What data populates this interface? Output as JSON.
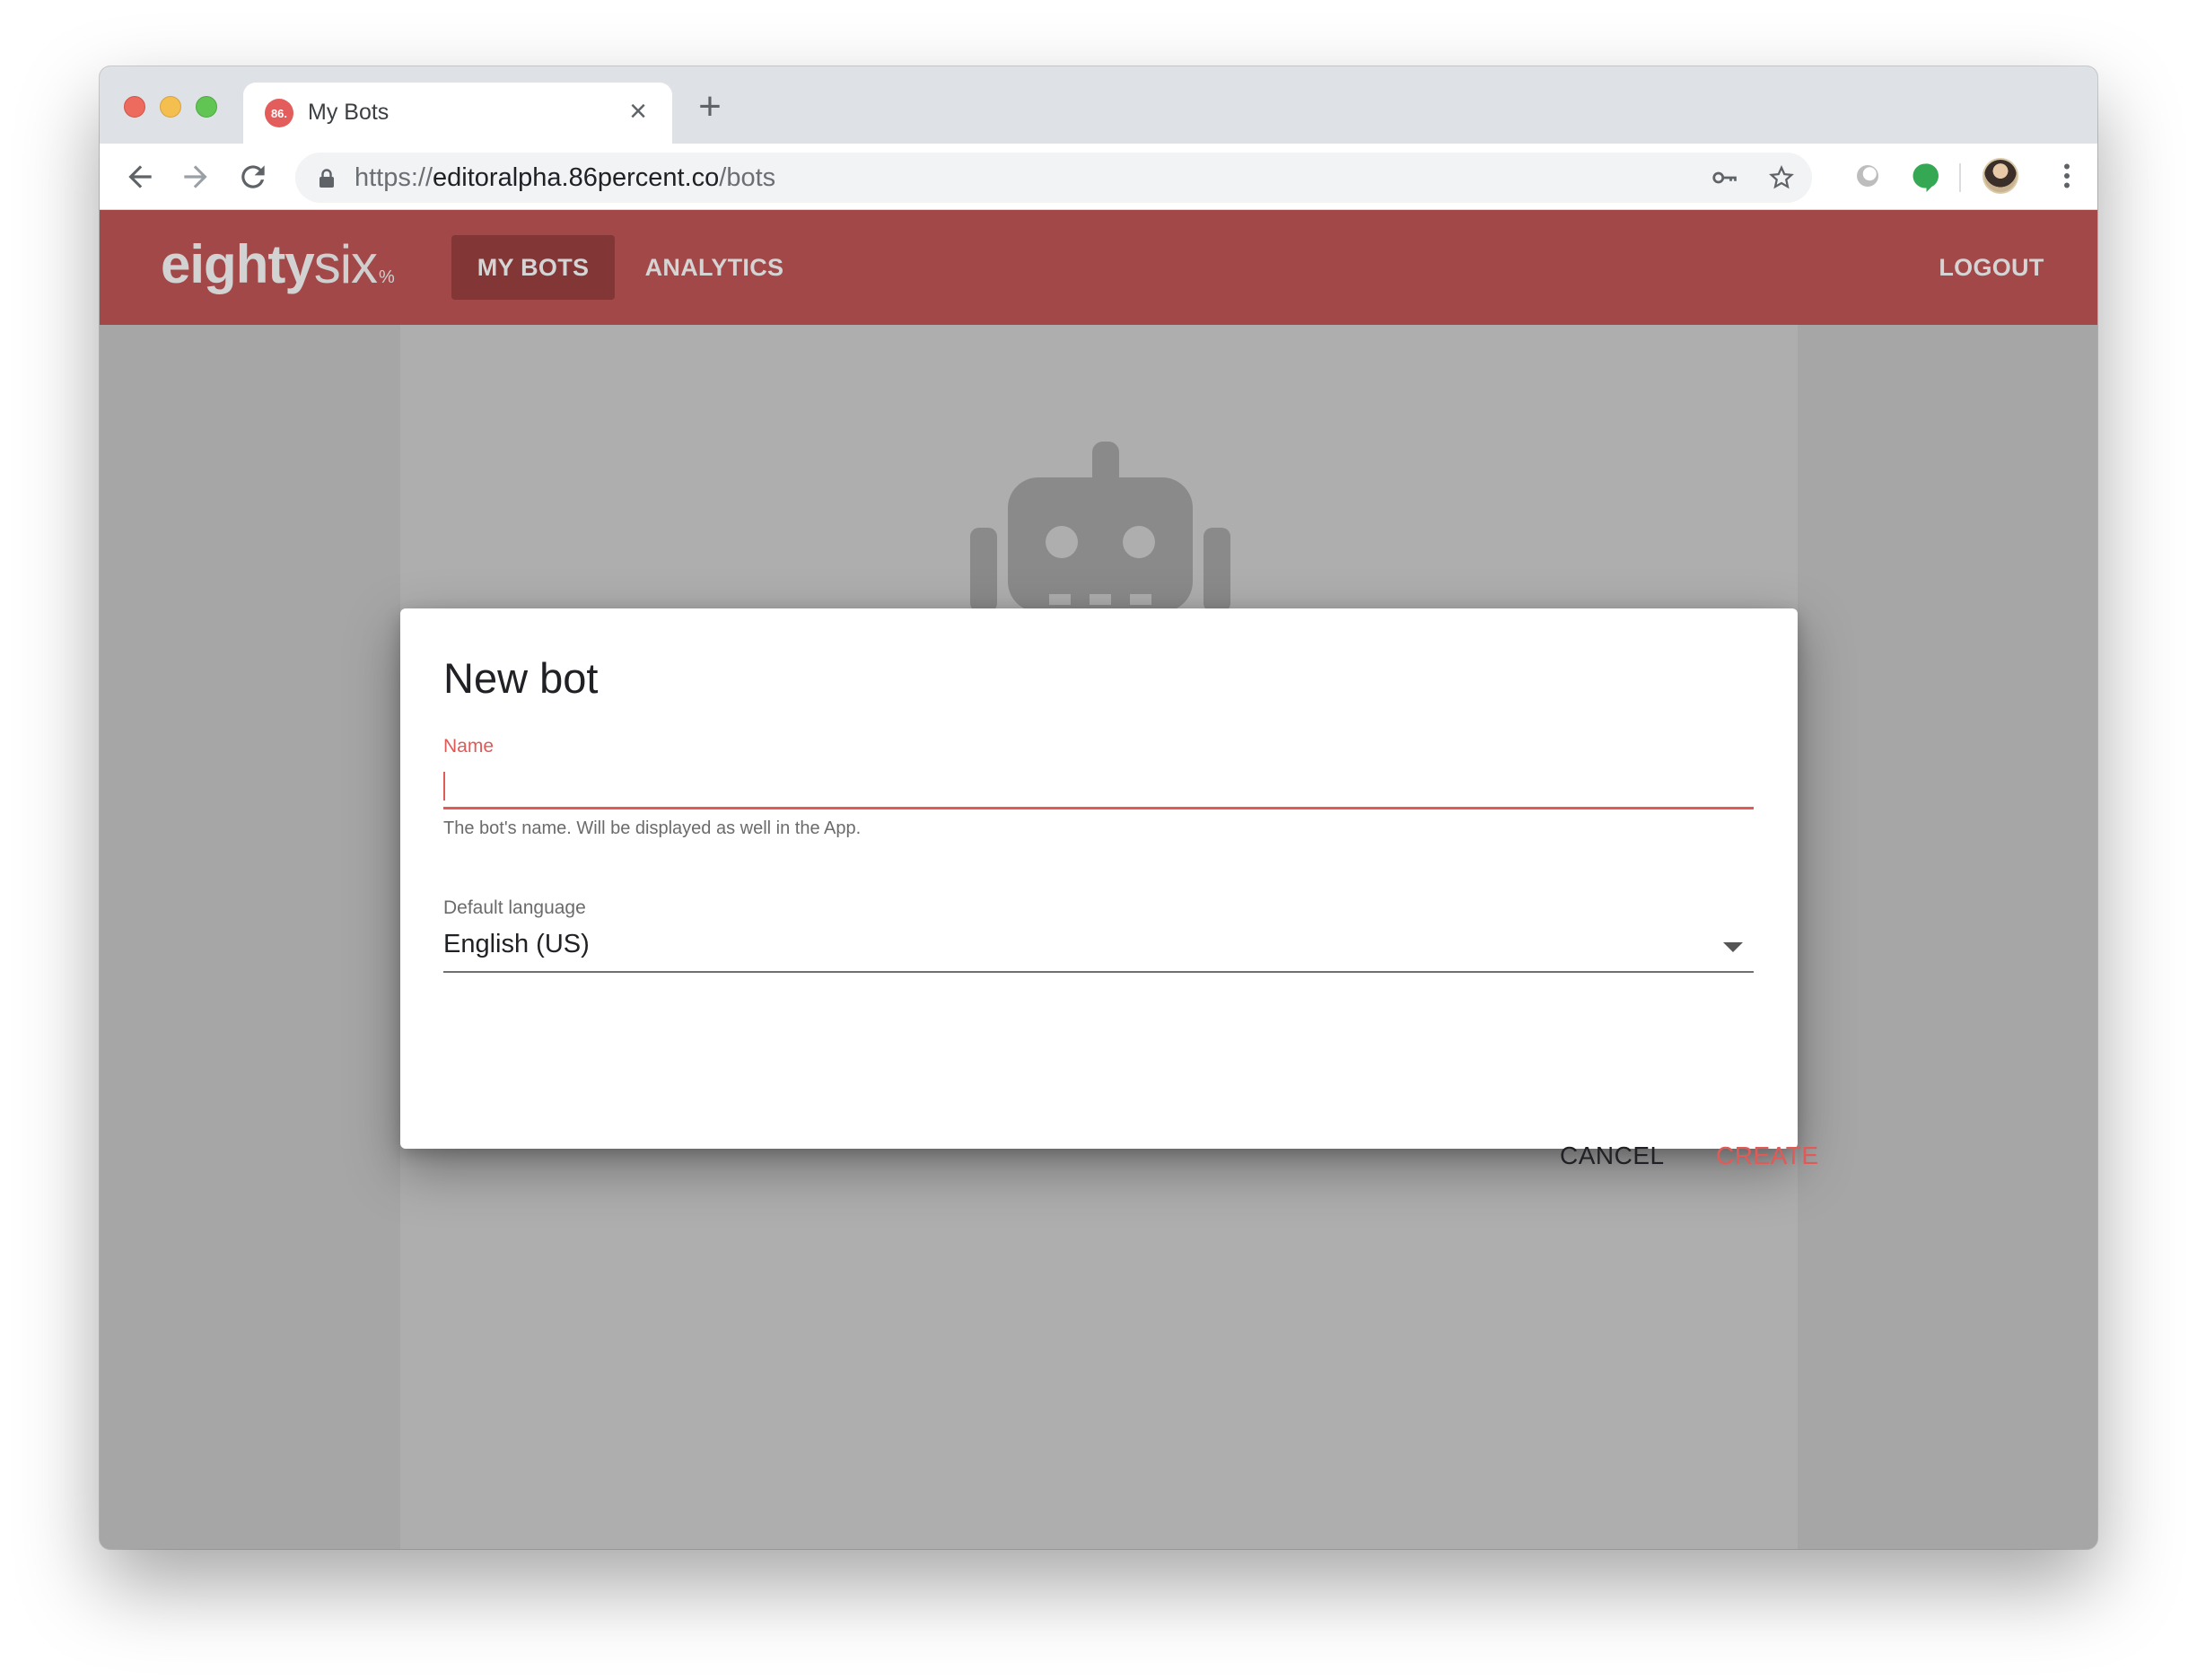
{
  "browser": {
    "tab_title": "My Bots",
    "favicon_text": "86.",
    "url_scheme": "https://",
    "url_host": "editoralpha.86percent.co",
    "url_path": "/bots"
  },
  "app": {
    "logo_bold": "eighty",
    "logo_thin": "six",
    "logo_suffix": "%",
    "nav": {
      "my_bots": "MY BOTS",
      "analytics": "ANALYTICS",
      "logout": "LOGOUT"
    },
    "brand_color": "#a24848"
  },
  "dialog": {
    "title": "New bot",
    "name_label": "Name",
    "name_value": "",
    "name_helper": "The bot's name. Will be displayed as well in the App.",
    "language_label": "Default language",
    "language_value": "English (US)",
    "cancel_label": "CANCEL",
    "create_label": "CREATE",
    "accent_color": "#e05a58"
  }
}
